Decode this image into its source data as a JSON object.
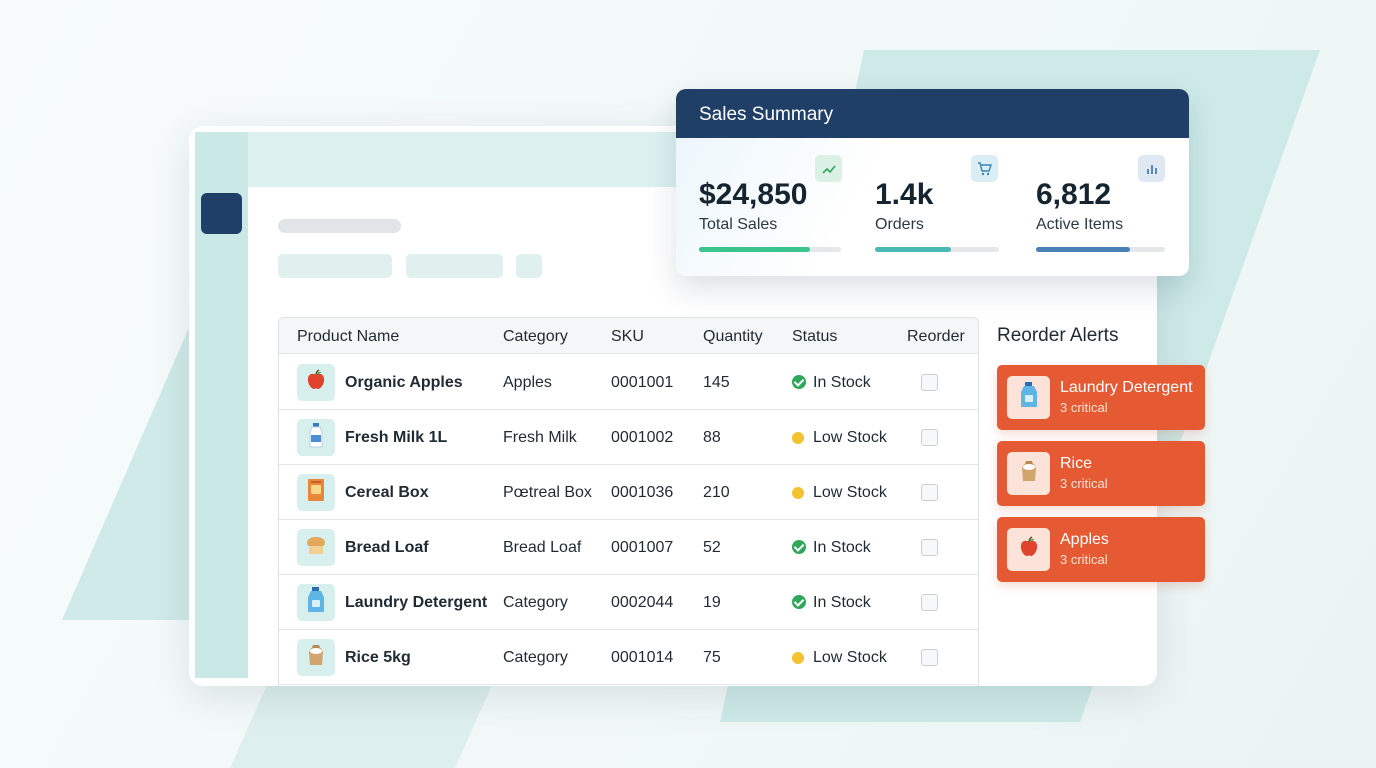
{
  "table": {
    "headers": {
      "product_name": "Product Name",
      "category": "Category",
      "sku": "SKU",
      "quantity": "Quantity",
      "status": "Status",
      "reorder": "Reorder"
    },
    "rows": [
      {
        "name": "Organic Apples",
        "category": "Apples",
        "sku": "0001001",
        "quantity": "145",
        "status": "In Stock",
        "status_color": "green",
        "icon": "apple-icon"
      },
      {
        "name": "Fresh Milk 1L",
        "category": "Fresh Milk",
        "sku": "0001002",
        "quantity": "88",
        "status": "Low Stock",
        "status_color": "yellow",
        "icon": "milk-bottle-icon"
      },
      {
        "name": "Cereal Box",
        "category": "Pœtreal Box",
        "sku": "0001036",
        "quantity": "210",
        "status": "Low Stock",
        "status_color": "yellow",
        "icon": "cereal-box-icon"
      },
      {
        "name": "Bread Loaf",
        "category": "Bread Loaf",
        "sku": "0001007",
        "quantity": "52",
        "status": "In Stock",
        "status_color": "green",
        "icon": "bread-icon"
      },
      {
        "name": "Laundry Detergent",
        "category": "Category",
        "sku": "0002044",
        "quantity": "19",
        "status": "In Stock",
        "status_color": "green",
        "icon": "detergent-bottle-icon"
      },
      {
        "name": "Rice 5kg",
        "category": "Category",
        "sku": "0001014",
        "quantity": "75",
        "status": "Low Stock",
        "status_color": "yellow",
        "icon": "rice-sack-icon"
      }
    ]
  },
  "alerts": {
    "title": "Reorder Alerts",
    "items": [
      {
        "name": "Laundry Detergent",
        "sub": "3 critical",
        "icon": "detergent-bottle-icon"
      },
      {
        "name": "Rice",
        "sub": "3 critical",
        "icon": "rice-sack-icon"
      },
      {
        "name": "Apples",
        "sub": "3 critical",
        "icon": "apple-icon"
      }
    ]
  },
  "summary": {
    "title": "Sales Summary",
    "stats": [
      {
        "value": "$24,850",
        "label": "Total Sales",
        "progress": 0.78,
        "bar_color": "#3cc48f",
        "icon": "trend-up-icon"
      },
      {
        "value": "1.4k",
        "label": "Orders",
        "progress": 0.61,
        "bar_color": "#4ab8b4",
        "icon": "cart-icon"
      },
      {
        "value": "6,812",
        "label": "Active Items",
        "progress": 0.73,
        "bar_color": "#4a80b4",
        "icon": "bar-chart-icon"
      }
    ]
  },
  "colors": {
    "brand_navy": "#1f3f66",
    "alert_orange": "#e55a32",
    "in_stock_green": "#2fa65a",
    "low_stock_yellow": "#f2c230",
    "sidebar_teal": "#c9e8e6"
  }
}
